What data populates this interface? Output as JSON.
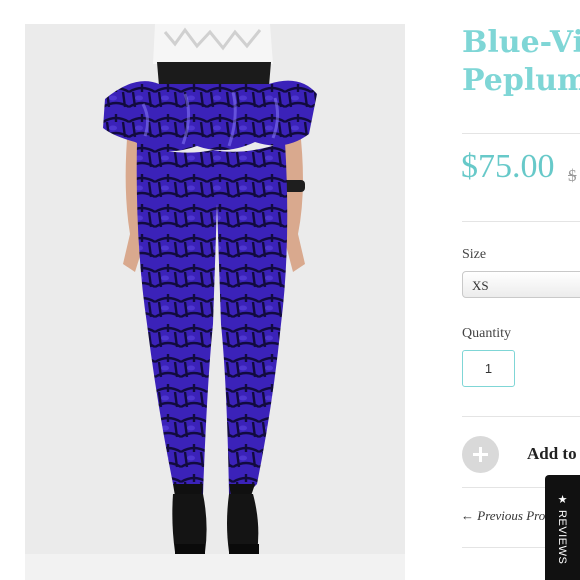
{
  "product": {
    "title_line1": "Blue-Vio",
    "title_line2": "Peplum",
    "price": "$75.00",
    "compare_price": "$",
    "size_label": "Size",
    "size_value": "XS",
    "quantity_label": "Quantity",
    "quantity_value": "1",
    "add_to_cart": "Add to"
  },
  "nav": {
    "previous": "← Previous Pro"
  },
  "reviews_tab": {
    "label": "★ REVIEWS"
  },
  "colors": {
    "accent": "#7fd6d6",
    "price": "#67c9c9",
    "garment": "#3a23b8"
  }
}
